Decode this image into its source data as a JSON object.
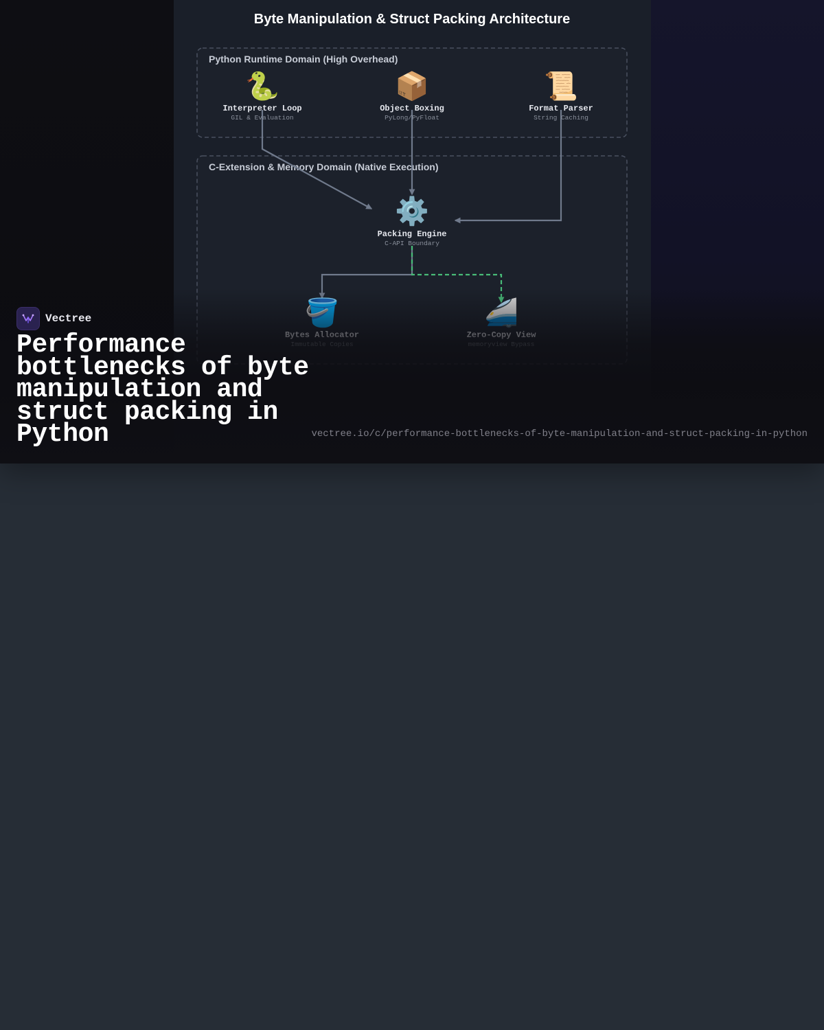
{
  "diagram": {
    "title": "Byte Manipulation & Struct Packing Architecture",
    "groups": [
      {
        "id": "python_runtime",
        "label": "Python Runtime Domain (High Overhead)"
      },
      {
        "id": "c_extension",
        "label": "C-Extension & Memory Domain (Native Execution)"
      }
    ],
    "nodes": [
      {
        "id": "interpreter_loop",
        "group": "python_runtime",
        "icon": "snake-icon",
        "emoji": "🐍",
        "label": "Interpreter Loop",
        "sublabel": "GIL & Evaluation"
      },
      {
        "id": "object_boxing",
        "group": "python_runtime",
        "icon": "package-icon",
        "emoji": "📦",
        "label": "Object Boxing",
        "sublabel": "PyLong/PyFloat"
      },
      {
        "id": "format_parser",
        "group": "python_runtime",
        "icon": "scroll-icon",
        "emoji": "📜",
        "label": "Format Parser",
        "sublabel": "String Caching"
      },
      {
        "id": "packing_engine",
        "group": "c_extension",
        "icon": "gear-icon",
        "emoji": "⚙️",
        "label": "Packing Engine",
        "sublabel": "C-API Boundary"
      },
      {
        "id": "bytes_allocator",
        "group": "c_extension",
        "icon": "bucket-icon",
        "emoji": "🪣",
        "label": "Bytes Allocator",
        "sublabel": "Immutable Copies"
      },
      {
        "id": "zero_copy_view",
        "group": "c_extension",
        "icon": "bullet-train-icon",
        "emoji": "🚄",
        "label": "Zero-Copy View",
        "sublabel": "memoryview Bypass"
      }
    ],
    "edges": [
      {
        "from": "interpreter_loop",
        "to": "packing_engine",
        "style": "solid"
      },
      {
        "from": "object_boxing",
        "to": "packing_engine",
        "style": "solid"
      },
      {
        "from": "format_parser",
        "to": "packing_engine",
        "style": "solid"
      },
      {
        "from": "packing_engine",
        "to": "bytes_allocator",
        "style": "solid"
      },
      {
        "from": "packing_engine",
        "to": "zero_copy_view",
        "style": "dashed"
      }
    ],
    "colors": {
      "edge": "#707a8c",
      "fast_path_edge": "#48bb78",
      "group_border": "#4a5160",
      "panel_background": "#1a1f29"
    }
  },
  "branding": {
    "name": "Vectree",
    "logo_icon": "vectree-logo-icon",
    "accent": "#8b5cf6"
  },
  "headline": "Performance bottlenecks of byte manipulation and struct packing in Python",
  "url": "vectree.io/c/performance-bottlenecks-of-byte-manipulation-and-struct-packing-in-python"
}
